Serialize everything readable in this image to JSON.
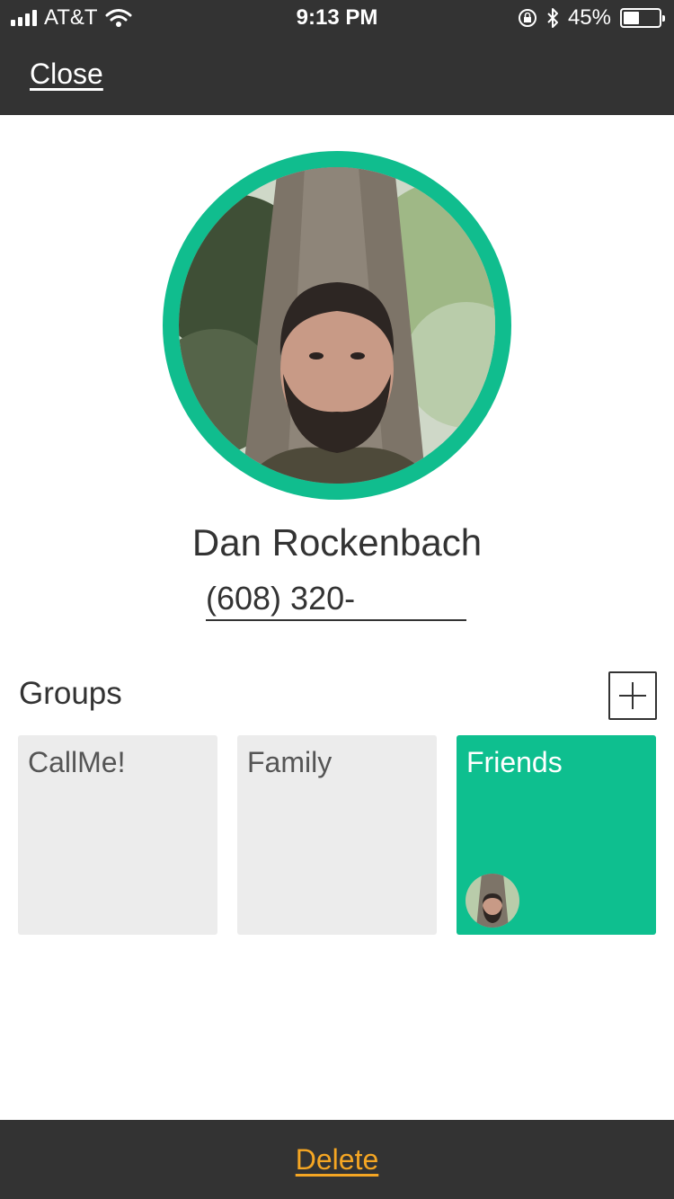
{
  "status_bar": {
    "carrier": "AT&T",
    "time": "9:13 PM",
    "battery_text": "45%",
    "battery_level": 0.45,
    "icons": [
      "signal-bars-icon",
      "wifi-icon",
      "rotation-lock-icon",
      "bluetooth-icon",
      "battery-icon"
    ]
  },
  "nav": {
    "close_label": "Close"
  },
  "contact": {
    "name": "Dan Rockenbach",
    "phone": "(608) 320-"
  },
  "groups": {
    "title": "Groups",
    "add_icon": "plus-icon",
    "items": [
      {
        "label": "CallMe!",
        "selected": false
      },
      {
        "label": "Family",
        "selected": false
      },
      {
        "label": "Friends",
        "selected": true
      }
    ]
  },
  "footer": {
    "delete_label": "Delete"
  },
  "colors": {
    "bar_background": "#333333",
    "accent_green": "#0ebf8f",
    "tile_gray": "#ececec",
    "delete_orange": "#f5a623"
  }
}
